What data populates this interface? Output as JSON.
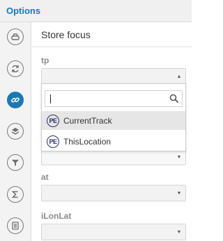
{
  "window": {
    "title": "Options"
  },
  "sidebar": {
    "items": [
      {
        "icon": "plugin-icon",
        "active": false
      },
      {
        "icon": "refresh-icon",
        "active": false
      },
      {
        "icon": "link-icon",
        "active": true
      },
      {
        "icon": "layers-icon",
        "active": false
      },
      {
        "icon": "filter-icon",
        "active": false
      },
      {
        "icon": "sigma-icon",
        "active": false
      },
      {
        "icon": "list-icon",
        "active": false
      }
    ]
  },
  "panel": {
    "section_title": "Store focus",
    "fields": [
      {
        "label": "tp",
        "value": ""
      },
      {
        "label": "at",
        "value": ""
      },
      {
        "label": "iLonLat",
        "value": ""
      }
    ],
    "dropdown": {
      "search_value": "",
      "options": [
        {
          "icon_text": "PE",
          "label": "CurrentTrack",
          "highlighted": true
        },
        {
          "icon_text": "PE",
          "label": "ThisLocation",
          "highlighted": false
        }
      ]
    }
  },
  "colors": {
    "accent": "#1a79b5",
    "pe_icon": "#27306e"
  }
}
